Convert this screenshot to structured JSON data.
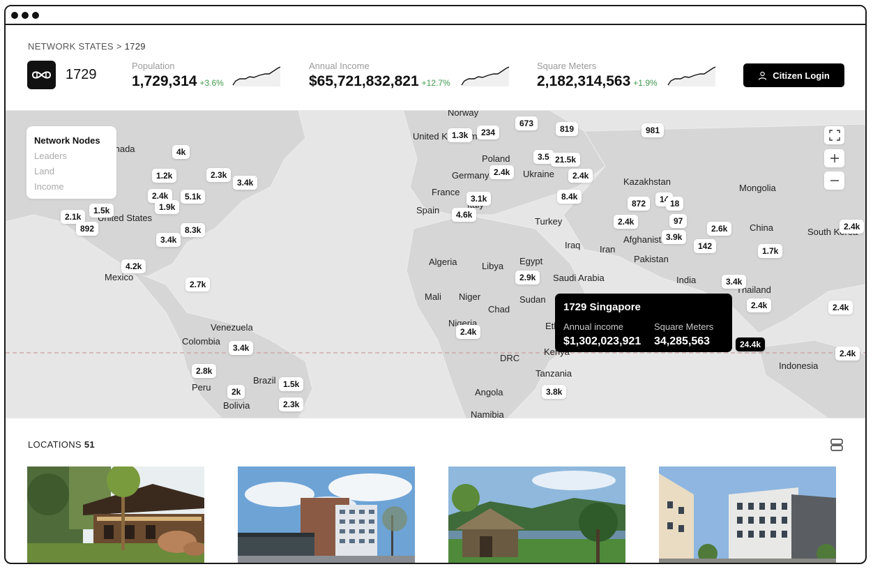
{
  "breadcrumb": {
    "section": "NETWORK STATES",
    "separator": ">",
    "current": "1729"
  },
  "brand": {
    "name": "1729",
    "logo_icon": "infinity-link-icon"
  },
  "stats": [
    {
      "label": "Population",
      "value": "1,729,314",
      "change": "+3.6%"
    },
    {
      "label": "Annual Income",
      "value": "$65,721,832,821",
      "change": "+12.7%"
    },
    {
      "label": "Square Meters",
      "value": "2,182,314,563",
      "change": "+1.9%"
    }
  ],
  "colors": {
    "positive_change": "#3f9a4c",
    "map_background": "#e6e6e6",
    "land": "#d6d6d6",
    "equator_line": "#c9a1a1"
  },
  "login": {
    "label": "Citizen Login",
    "icon": "user-icon"
  },
  "legend": {
    "title": "Network Nodes",
    "items": [
      "Leaders",
      "Land",
      "Income"
    ]
  },
  "map_controls": {
    "fullscreen_icon": "fullscreen-icon",
    "zoom_in_icon": "plus-icon",
    "zoom_out_icon": "minus-icon"
  },
  "countries": [
    "Norway",
    "United Kingdom",
    "Poland",
    "Germany",
    "Ukraine",
    "France",
    "Italy",
    "Spain",
    "Kazakhstan",
    "Mongolia",
    "Turkey",
    "Afghanistan",
    "China",
    "South Korea",
    "Iraq",
    "Iran",
    "Pakistan",
    "India",
    "Thailand",
    "Algeria",
    "Libya",
    "Egypt",
    "Saudi Arabia",
    "Mali",
    "Niger",
    "Chad",
    "Sudan",
    "Nigeria",
    "Ethiopia",
    "Kenya",
    "DRC",
    "Tanzania",
    "Angola",
    "Namibia",
    "Indonesia",
    "Canada",
    "United States",
    "Mexico",
    "Venezuela",
    "Colombia",
    "Peru",
    "Brazil",
    "Bolivia"
  ],
  "pins": [
    "1.3k",
    "234",
    "673",
    "819",
    "981",
    "4k",
    "1.2k",
    "2.3k",
    "3.4k",
    "2.4k",
    "5.1k",
    "1.9k",
    "2.1k",
    "1.5k",
    "892",
    "8.3k",
    "3.4k",
    "4.2k",
    "2.7k",
    "3.5",
    "21.5k",
    "2.4k",
    "2.4k",
    "3.1k",
    "4.6k",
    "8.4k",
    "872",
    "14",
    "18",
    "2.4k",
    "97",
    "3.9k",
    "2.6k",
    "142",
    "1.7k",
    "2.4k",
    "2.9k",
    "3.4k",
    "2.4k",
    "2.4k",
    "2.4k",
    "3.4k",
    "2.8k",
    "2k",
    "1.5k",
    "2.3k",
    "3.8k",
    "24.4k",
    "2.4k"
  ],
  "tooltip": {
    "title": "1729 Singapore",
    "income_label": "Annual income",
    "income_value": "$1,302,023,921",
    "area_label": "Square Meters",
    "area_value": "34,285,563"
  },
  "locations": {
    "title": "LOCATIONS",
    "count": "51",
    "layout_icon": "rows-layout-icon"
  },
  "photos": [
    {
      "description": "wooden-house-forest"
    },
    {
      "description": "modern-office-building"
    },
    {
      "description": "thatched-hut-lake"
    },
    {
      "description": "city-apartment-blocks"
    }
  ]
}
